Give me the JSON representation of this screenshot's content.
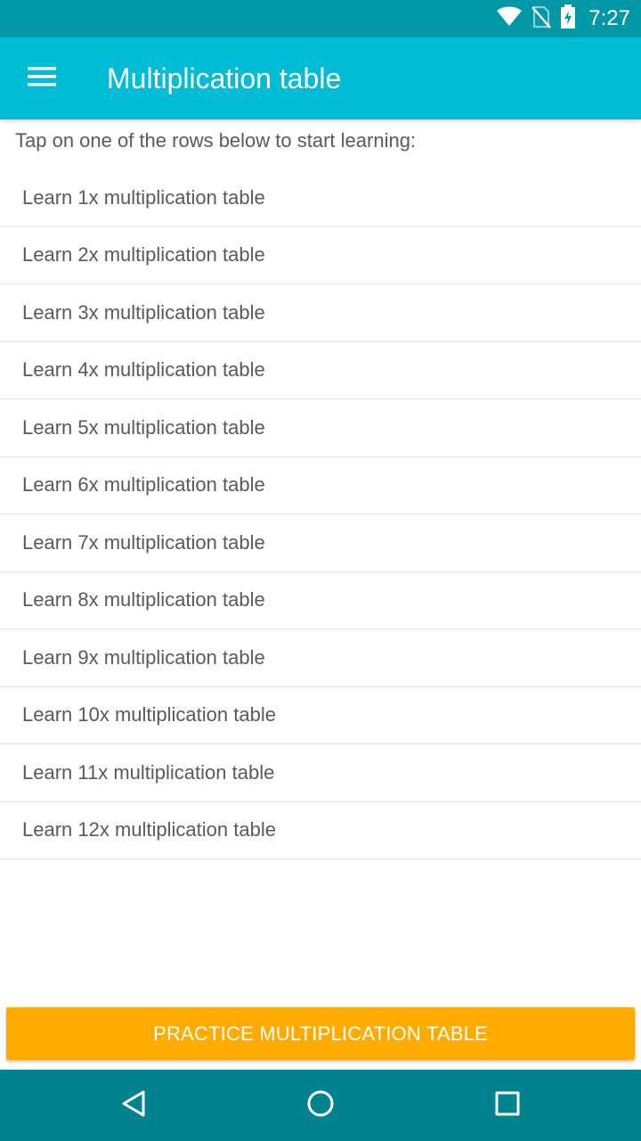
{
  "status_bar": {
    "time": "7:27",
    "icons": [
      "wifi-icon",
      "no-sim-icon",
      "battery-charging-icon"
    ],
    "color": "#0097a7"
  },
  "app_bar": {
    "title": "Multiplication table",
    "menu_icon": "hamburger-menu-icon",
    "color": "#00bcd4"
  },
  "content": {
    "instructions": "Tap on one of the rows below to start learning:",
    "tables": [
      "Learn 1x multiplication table",
      "Learn 2x multiplication table",
      "Learn 3x multiplication table",
      "Learn 4x multiplication table",
      "Learn 5x multiplication table",
      "Learn 6x multiplication table",
      "Learn 7x multiplication table",
      "Learn 8x multiplication table",
      "Learn 9x multiplication table",
      "Learn 10x multiplication table",
      "Learn 11x multiplication table",
      "Learn 12x multiplication table"
    ]
  },
  "practice_button": {
    "label": "PRACTICE MULTIPLICATION TABLE",
    "color": "#ffab00"
  },
  "nav_bar": {
    "buttons": [
      "back-icon",
      "home-icon",
      "recents-icon"
    ],
    "color": "#00838f"
  }
}
